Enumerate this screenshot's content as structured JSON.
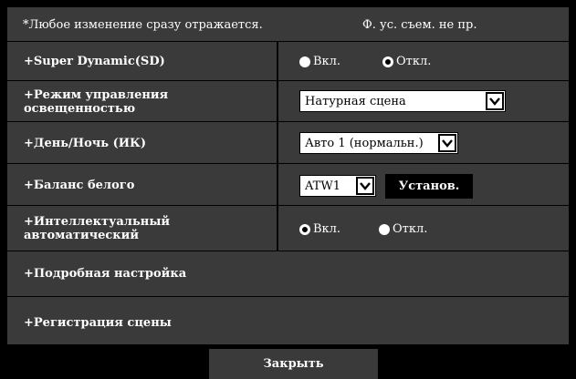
{
  "header": {
    "note": "*Любое изменение сразу отражается.",
    "shortcut": "Ф. ус. съем. не пр."
  },
  "rows": {
    "super_dynamic": {
      "label": "+Super Dynamic(SD)",
      "on_label": "Вкл.",
      "off_label": "Откл.",
      "selected": "off"
    },
    "light_control": {
      "label_line1": "+Режим управления",
      "label_line2": "освещенностью",
      "value": "Натурная сцена"
    },
    "day_night": {
      "label": "+День/Ночь (ИК)",
      "value": "Авто 1 (нормальн.)"
    },
    "white_balance": {
      "label": "+Баланс белого",
      "value": "ATW1",
      "set_label": "Установ."
    },
    "intelligent_auto": {
      "label_line1": "+Интеллектуальный",
      "label_line2": "автоматический",
      "on_label": "Вкл.",
      "off_label": "Откл.",
      "selected": "on"
    },
    "detail": {
      "label": "+Подробная настройка"
    },
    "scene": {
      "label": "+Регистрация сцены"
    }
  },
  "footer": {
    "close_label": "Закрыть"
  }
}
